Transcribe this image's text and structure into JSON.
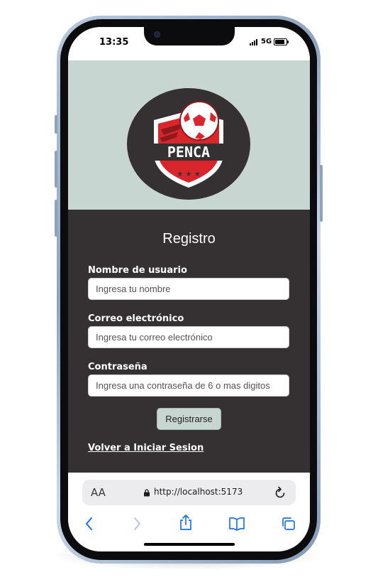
{
  "status_bar": {
    "time": "13:35",
    "network": "5G",
    "icons": [
      "signal-icon",
      "battery-icon"
    ]
  },
  "hero": {
    "logo_text": "PENCA",
    "logo_icon": "soccer-ball-shield-icon",
    "colors": {
      "background": "#c8d6d2",
      "logo_circle": "#353132",
      "accent": "#d8262c"
    }
  },
  "form": {
    "title": "Registro",
    "username": {
      "label": "Nombre de usuario",
      "placeholder": "Ingresa tu nombre",
      "value": ""
    },
    "email": {
      "label": "Correo electrónico",
      "placeholder": "Ingresa tu correo electrónico",
      "value": ""
    },
    "password": {
      "label": "Contraseña",
      "placeholder": "Ingresa una contraseña de 6 o mas digitos",
      "value": ""
    },
    "submit_label": "Registrarse",
    "back_link": "Volver a Iniciar Sesion",
    "colors": {
      "background": "#353132",
      "text": "#ffffff",
      "button": "#c8d6d2"
    }
  },
  "browser": {
    "text_size_button": "AA",
    "url": "http://localhost:5173",
    "icons": [
      "lock-icon",
      "reload-icon",
      "back-arrow-icon",
      "forward-arrow-icon",
      "share-icon",
      "bookmarks-icon",
      "tabs-icon"
    ]
  }
}
